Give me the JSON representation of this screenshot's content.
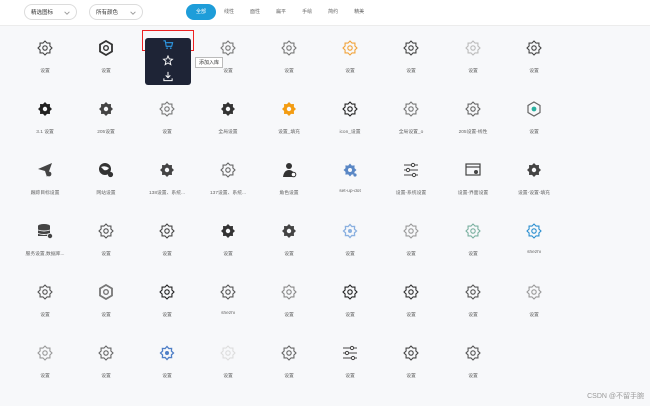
{
  "filters": {
    "selectA": "精选图标",
    "selectB": "所有颜色"
  },
  "tabs": [
    "全部",
    "线性",
    "面性",
    "扁平",
    "手绘",
    "简约",
    "精美"
  ],
  "active_tab_index": 0,
  "popup": {
    "tooltip": "添加入库"
  },
  "icons": [
    [
      {
        "label": "设置",
        "icon": "gear-outline-icon",
        "color": "#444"
      },
      {
        "label": "设置",
        "icon": "hex-gear-icon",
        "color": "#333"
      },
      {
        "label": "",
        "icon": "popup-slot",
        "color": "#333"
      },
      {
        "label": "设置",
        "icon": "gear-outline-icon",
        "color": "#777"
      },
      {
        "label": "设置",
        "icon": "gear-outline-icon",
        "color": "#777"
      },
      {
        "label": "设置",
        "icon": "gear-outline-icon",
        "color": "#f1a33a"
      },
      {
        "label": "设置",
        "icon": "gear-outline-icon",
        "color": "#444"
      },
      {
        "label": "设置",
        "icon": "gear-outline-icon",
        "color": "#bbb"
      },
      {
        "label": "设置",
        "icon": "gear-outline-icon",
        "color": "#444"
      }
    ],
    [
      {
        "label": "3.1 设置",
        "icon": "gear-filled-icon",
        "color": "#222"
      },
      {
        "label": "205设置",
        "icon": "gear-filled-icon",
        "color": "#444"
      },
      {
        "label": "设置",
        "icon": "gear-outline-icon",
        "color": "#777"
      },
      {
        "label": "全局设置",
        "icon": "gear-filled-icon",
        "color": "#333"
      },
      {
        "label": "设置_填充",
        "icon": "gear-filled-icon",
        "color": "#f39c12"
      },
      {
        "label": "icon_设置",
        "icon": "gear-outline-icon",
        "color": "#222"
      },
      {
        "label": "全局设置_o",
        "icon": "gear-outline-icon",
        "color": "#777"
      },
      {
        "label": "205设置-线性",
        "icon": "gear-outline-icon",
        "color": "#666"
      },
      {
        "label": "设置",
        "icon": "hex-teal-icon",
        "color": "#2ab0a0"
      }
    ],
    [
      {
        "label": "跟踪目标设置",
        "icon": "paper-plane-icon",
        "color": "#444"
      },
      {
        "label": "网站设置",
        "icon": "globe-gear-icon",
        "color": "#333"
      },
      {
        "label": "138设置、系统...",
        "icon": "gear-filled-icon",
        "color": "#444"
      },
      {
        "label": "137设置、系统...",
        "icon": "gear-outline-icon",
        "color": "#666"
      },
      {
        "label": "角色设置",
        "icon": "person-gear-icon",
        "color": "#333"
      },
      {
        "label": "set-up-dot",
        "icon": "gear-dots-icon",
        "color": "#5a87c5"
      },
      {
        "label": "设置-系统设置",
        "icon": "sliders-icon",
        "color": "#444"
      },
      {
        "label": "设置-界面设置",
        "icon": "window-gear-icon",
        "color": "#444"
      },
      {
        "label": "设置-设置-填充",
        "icon": "gear-filled-icon",
        "color": "#444"
      }
    ],
    [
      {
        "label": "服务设置,数据库...",
        "icon": "database-gear-icon",
        "color": "#444"
      },
      {
        "label": "设置",
        "icon": "gear-outline-icon",
        "color": "#555"
      },
      {
        "label": "设置",
        "icon": "gear-outline-icon",
        "color": "#444"
      },
      {
        "label": "设置",
        "icon": "gear-filled-icon",
        "color": "#333"
      },
      {
        "label": "设置",
        "icon": "gear-filled-icon",
        "color": "#444"
      },
      {
        "label": "设置",
        "icon": "gear-blue-icon",
        "color": "#8ab0e0"
      },
      {
        "label": "设置",
        "icon": "gear-outline-icon",
        "color": "#999"
      },
      {
        "label": "设置",
        "icon": "gear-outline-icon",
        "color": "#7ab0a0"
      },
      {
        "label": "shezhi",
        "icon": "gear-outline-icon",
        "color": "#2a8fd0"
      }
    ],
    [
      {
        "label": "设置",
        "icon": "gear-outline-icon",
        "color": "#555"
      },
      {
        "label": "设置",
        "icon": "hex-gear-icon",
        "color": "#777"
      },
      {
        "label": "设置",
        "icon": "gear-outline-icon",
        "color": "#222"
      },
      {
        "label": "shezhi",
        "icon": "gear-outline-icon",
        "color": "#555"
      },
      {
        "label": "设置",
        "icon": "gear-outline-icon",
        "color": "#888"
      },
      {
        "label": "设置",
        "icon": "gear-outline-icon",
        "color": "#222"
      },
      {
        "label": "设置",
        "icon": "gear-outline-icon",
        "color": "#333"
      },
      {
        "label": "设置",
        "icon": "gear-outline-icon",
        "color": "#555"
      },
      {
        "label": "设置",
        "icon": "gear-outline-icon",
        "color": "#999"
      }
    ],
    [
      {
        "label": "设置",
        "icon": "gear-outline-icon",
        "color": "#999"
      },
      {
        "label": "设置",
        "icon": "gear-outline-icon",
        "color": "#666"
      },
      {
        "label": "设置",
        "icon": "gear-blue-icon",
        "color": "#4f7fc7"
      },
      {
        "label": "设置",
        "icon": "gear-outline-icon",
        "color": "#ddd"
      },
      {
        "label": "设置",
        "icon": "gear-outline-icon",
        "color": "#666"
      },
      {
        "label": "设置",
        "icon": "sliders-icon",
        "color": "#444"
      },
      {
        "label": "设置",
        "icon": "gear-outline-icon",
        "color": "#444"
      },
      {
        "label": "设置",
        "icon": "gear-outline-icon",
        "color": "#555"
      },
      {
        "label": "",
        "icon": "blank",
        "color": "#ddd"
      }
    ]
  ],
  "watermark": "CSDN @不留手腕"
}
